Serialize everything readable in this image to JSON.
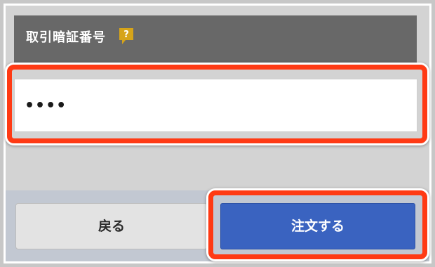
{
  "form": {
    "pin_label": "取引暗証番号",
    "help_icon": "question-mark-icon",
    "pin_value": "••••",
    "colors": {
      "header_bg": "#686868",
      "help_icon": "#d6a419",
      "highlight": "#ff3a14",
      "order_button": "#3a63c0"
    }
  },
  "actions": {
    "back_label": "戻る",
    "order_label": "注文する"
  }
}
